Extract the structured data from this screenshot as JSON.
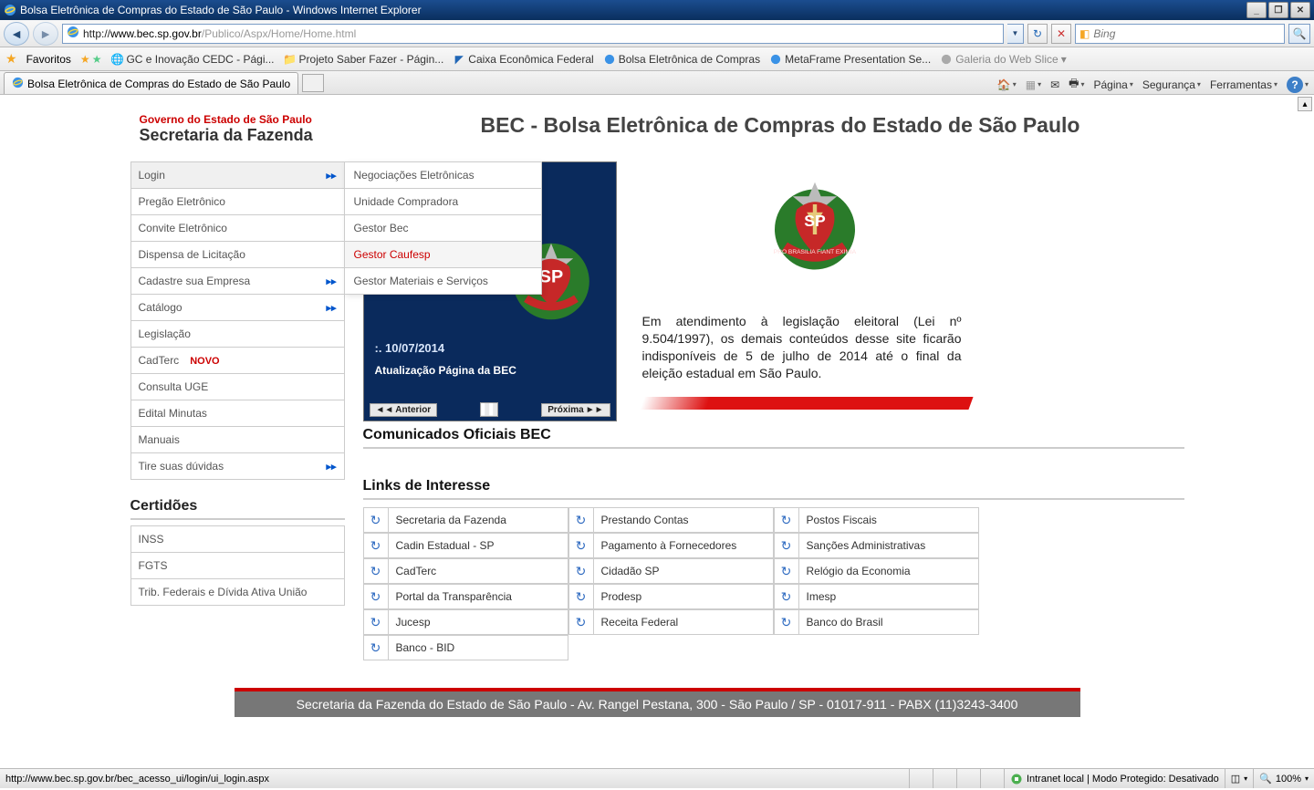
{
  "window": {
    "title": "Bolsa Eletrônica de Compras do Estado de São Paulo - Windows Internet Explorer"
  },
  "address": {
    "url_prefix": "http://",
    "url_host": "www.bec.sp.gov.br",
    "url_path": "/Publico/Aspx/Home/Home.html"
  },
  "search": {
    "placeholder": "Bing"
  },
  "favorites": {
    "label": "Favoritos",
    "items": [
      "GC e Inovação CEDC - Pági...",
      "Projeto Saber Fazer - Págin...",
      "Caixa Econômica Federal",
      "Bolsa Eletrônica de Compras",
      "MetaFrame Presentation Se...",
      "Galeria do Web Slice"
    ]
  },
  "tab": {
    "title": "Bolsa Eletrônica de Compras do Estado de São Paulo"
  },
  "tabtools": {
    "pagina": "Página",
    "seguranca": "Segurança",
    "ferramentas": "Ferramentas"
  },
  "logo": {
    "line1": "Governo do Estado de São Paulo",
    "line2": "Secretaria da Fazenda"
  },
  "main_title": "BEC - Bolsa Eletrônica de Compras do Estado de São Paulo",
  "menu": {
    "items": [
      {
        "label": "Login",
        "arrow": true
      },
      {
        "label": "Pregão Eletrônico",
        "arrow": false
      },
      {
        "label": "Convite Eletrônico",
        "arrow": false
      },
      {
        "label": "Dispensa de Licitação",
        "arrow": false
      },
      {
        "label": "Cadastre sua Empresa",
        "arrow": true
      },
      {
        "label": "Catálogo",
        "arrow": true
      },
      {
        "label": "Legislação",
        "arrow": false
      },
      {
        "label": "CadTerc",
        "arrow": false,
        "novo": "NOVO"
      },
      {
        "label": "Consulta UGE",
        "arrow": false
      },
      {
        "label": "Edital Minutas",
        "arrow": false
      },
      {
        "label": "Manuais",
        "arrow": false
      },
      {
        "label": "Tire suas dúvidas",
        "arrow": true
      }
    ]
  },
  "submenu": {
    "items": [
      "Negociações Eletrônicas",
      "Unidade Compradora",
      "Gestor Bec",
      "Gestor Caufesp",
      "Gestor Materiais e Serviços"
    ],
    "active_index": 3
  },
  "certidoes": {
    "heading": "Certidões",
    "items": [
      "INSS",
      "FGTS",
      "Trib. Federais e Dívida Ativa União"
    ]
  },
  "news": {
    "date": ":. 10/07/2014",
    "title": "Atualização Página da BEC",
    "prev": "Anterior",
    "next": "Próxima"
  },
  "comunicados_h": "Comunicados Oficiais BEC",
  "info_text": "Em atendimento à legislação eleitoral (Lei nº 9.504/1997), os demais conteúdos desse site ficarão indisponíveis de 5 de julho de 2014 até o final da eleição estadual em São Paulo.",
  "links": {
    "heading": "Links de Interesse",
    "items": [
      "Secretaria da Fazenda",
      "Prestando Contas",
      "Postos Fiscais",
      "Cadin Estadual - SP",
      "Pagamento à Fornecedores",
      "Sanções Administrativas",
      "CadTerc",
      "Cidadão SP",
      "Relógio da Economia",
      "Portal da Transparência",
      "Prodesp",
      "Imesp",
      "Jucesp",
      "Receita Federal",
      "Banco do Brasil",
      "Banco - BID"
    ]
  },
  "footer": "Secretaria da Fazenda do Estado de São Paulo - Av. Rangel Pestana, 300 - São Paulo / SP - 01017-911 - PABX (11)3243-3400",
  "status": {
    "url": "http://www.bec.sp.gov.br/bec_acesso_ui/login/ui_login.aspx",
    "zone": "Intranet local | Modo Protegido: Desativado",
    "zoom": "100%"
  },
  "icons": {
    "refresh": "↻",
    "stop": "✕",
    "search_glyph": "🔍"
  }
}
